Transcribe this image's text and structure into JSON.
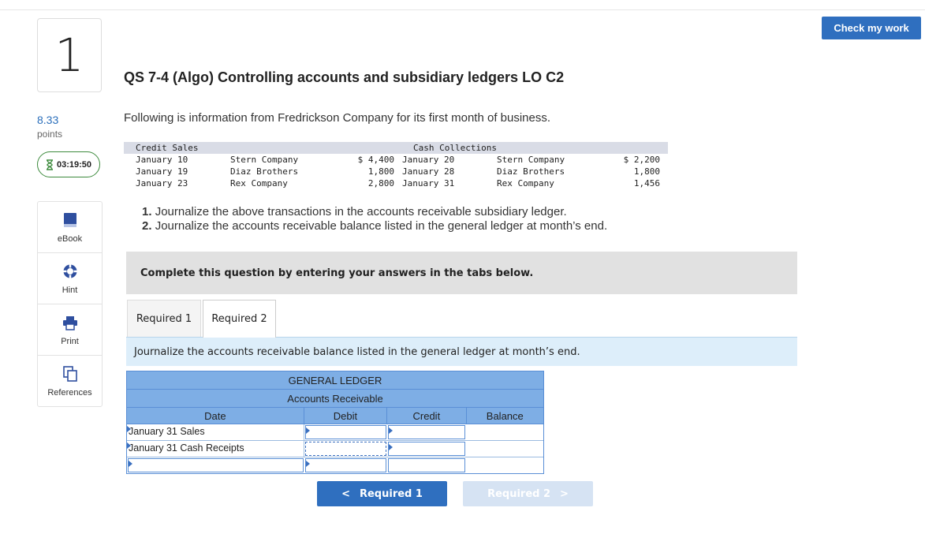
{
  "question": {
    "number": "1",
    "points_value": "8.33",
    "points_label": "points",
    "timer": "03:19:50",
    "title": "QS 7-4 (Algo) Controlling accounts and subsidiary ledgers LO C2",
    "intro": "Following is information from Fredrickson Company for its first month of business."
  },
  "tools": [
    {
      "label": "eBook",
      "icon": "book-icon"
    },
    {
      "label": "Hint",
      "icon": "lifebuoy-icon"
    },
    {
      "label": "Print",
      "icon": "printer-icon"
    },
    {
      "label": "References",
      "icon": "copy-icon"
    }
  ],
  "check_button": "Check my work",
  "data_table": {
    "header_left": "Credit Sales",
    "header_right": "Cash Collections",
    "rows": [
      {
        "date1": "January 10",
        "name1": "Stern Company",
        "amt1": "$ 4,400",
        "date2": "January 20",
        "name2": "Stern Company",
        "amt2": "$ 2,200"
      },
      {
        "date1": "January 19",
        "name1": "Diaz Brothers",
        "amt1": "1,800",
        "date2": "January 28",
        "name2": "Diaz Brothers",
        "amt2": "1,800"
      },
      {
        "date1": "January 23",
        "name1": "Rex Company",
        "amt1": "2,800",
        "date2": "January 31",
        "name2": "Rex Company",
        "amt2": "1,456"
      }
    ]
  },
  "instructions": [
    {
      "num": "1.",
      "text": "Journalize the above transactions in the accounts receivable subsidiary ledger."
    },
    {
      "num": "2.",
      "text": "Journalize the accounts receivable balance listed in the general ledger at month’s end."
    }
  ],
  "complete_banner": "Complete this question by entering your answers in the tabs below.",
  "tabs": [
    {
      "label": "Required 1"
    },
    {
      "label": "Required 2"
    }
  ],
  "tab_instruction": "Journalize the accounts receivable balance listed in the general ledger at month’s end.",
  "ledger": {
    "title": "GENERAL LEDGER",
    "account": "Accounts Receivable",
    "columns": [
      "Date",
      "Debit",
      "Credit",
      "Balance"
    ],
    "rows": [
      {
        "date": "January 31 Sales",
        "debit": "",
        "credit": "",
        "balance": ""
      },
      {
        "date": "January 31 Cash Receipts",
        "debit": "",
        "credit": "",
        "balance": ""
      },
      {
        "date": "",
        "debit": "",
        "credit": "",
        "balance": ""
      }
    ]
  },
  "nav": {
    "prev_label": "Required 1",
    "next_label": "Required 2"
  },
  "colors": {
    "accent": "#2f6fbf",
    "ledger_header": "#7eaee5",
    "timer_border": "#3c8a3c"
  }
}
